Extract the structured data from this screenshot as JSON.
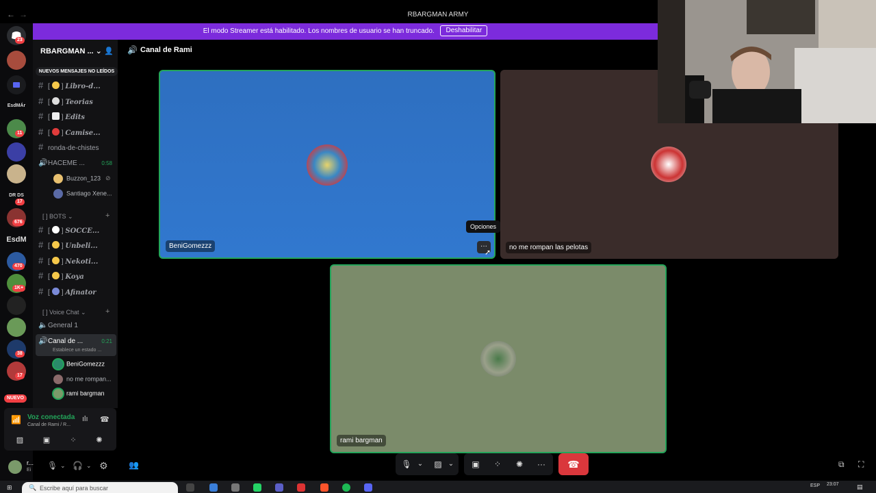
{
  "window": {
    "title": "RBARGMAN ARMY"
  },
  "banner": {
    "text": "El modo Streamer está habilitado. Los nombres de usuario se han truncado.",
    "button": "Deshabilitar"
  },
  "rail": {
    "badges": [
      "23",
      "11",
      "17",
      "676",
      "470",
      "1K+",
      "38",
      "17"
    ],
    "labels": {
      "esdmar": "EsdMÁr",
      "esdm": "EsdM",
      "drds": "DR DS",
      "nuevo": "NUEVO"
    }
  },
  "sidebar": {
    "server_name": "RBARGMAN ...",
    "new_messages": "NUEVOS MENSAJES NO LEÍDOS",
    "text_channels": [
      {
        "bracket": "[",
        "name": "Libro-d...",
        "close": "]"
      },
      {
        "bracket": "[",
        "name": "Teorias",
        "close": "]"
      },
      {
        "bracket": "[",
        "name": "Edits",
        "close": "]"
      },
      {
        "bracket": "[",
        "name": "Camise...",
        "close": "]"
      }
    ],
    "plain_channel": "ronda-de-chistes",
    "voice_channel_1": {
      "name": "HACEME ...",
      "time": "0:58",
      "users": [
        "Buzzon_123",
        "Santiago Xene..."
      ]
    },
    "category_bots": "[ ] BOTS",
    "bot_channels": [
      {
        "name": "SOCCE..."
      },
      {
        "name": "Unbeli..."
      },
      {
        "name": "Nekoti..."
      },
      {
        "name": "Koya"
      },
      {
        "name": "Afinator"
      }
    ],
    "category_voice": "[ ] Voice Chat",
    "voice_general": "General 1",
    "voice_channel_2": {
      "name": "Canal de ...",
      "time": "0:21",
      "status": "Establece un estado ...",
      "users": [
        "BeniGomezzz",
        "no me rompan...",
        "rami bargman"
      ]
    }
  },
  "voice_panel": {
    "status": "Voz conectada",
    "sub": "Canal de Rami / R..."
  },
  "user_panel": {
    "name": "r...",
    "status": "Ei"
  },
  "call": {
    "title": "Canal de Rami",
    "tiles": [
      {
        "name": "BeniGomezzz",
        "bg": "#2f74c7"
      },
      {
        "name": "no me rompan las pelotas",
        "bg": "#3a2c2a"
      },
      {
        "name": "rami bargman",
        "bg": "#7b8b6a"
      }
    ],
    "tooltip": "Opciones",
    "options": "···"
  },
  "taskbar": {
    "search_placeholder": "Escribe aquí para buscar",
    "time": "23:07",
    "lang": "ESP"
  },
  "colors": {
    "speaking": "#23a55a",
    "hangup": "#da373c",
    "banner": "#7c2bdc"
  }
}
